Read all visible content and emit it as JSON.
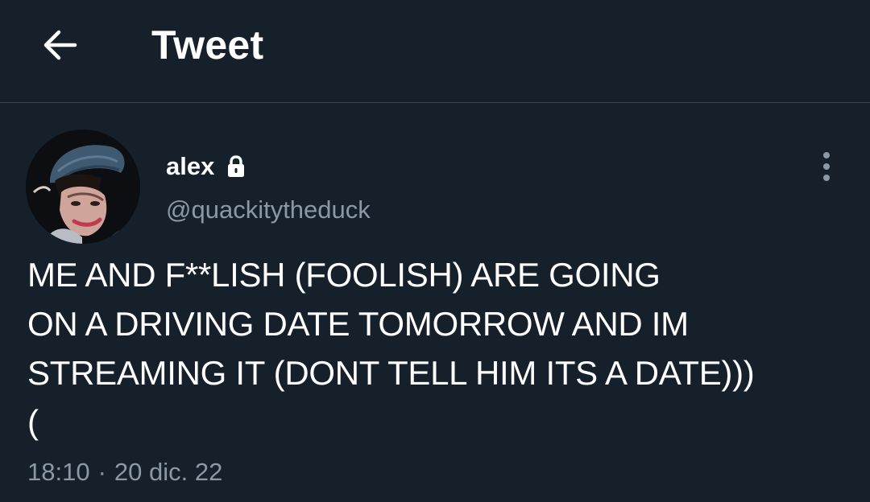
{
  "header": {
    "title": "Tweet",
    "back_icon": "arrow-left-icon"
  },
  "tweet": {
    "author": {
      "display_name": "alex",
      "handle": "@quackitytheduck",
      "protected_icon": "lock-icon",
      "avatar": "avatar"
    },
    "text": "ME AND F**LISH (FOOLISH) ARE GOING\nON A DRIVING DATE TOMORROW AND IM\nSTREAMING IT (DONT TELL HIM ITS A DATE)))\n(",
    "time": "18:10",
    "separator": "·",
    "date": "20 dic. 22",
    "more_icon": "more-vertical-icon"
  },
  "colors": {
    "background": "#15202b",
    "text": "#ffffff",
    "secondary_text": "#8b98a5",
    "divider": "#38444d"
  }
}
